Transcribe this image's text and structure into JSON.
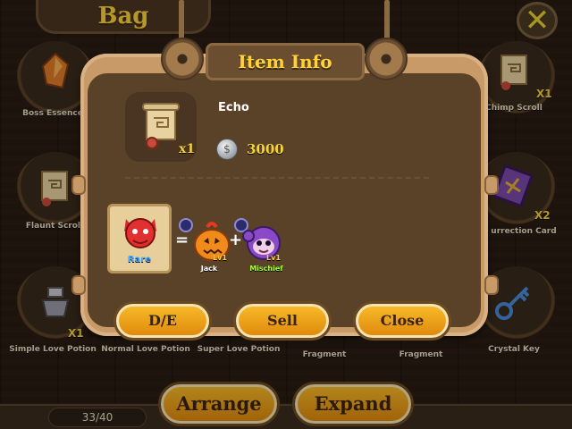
{
  "screen": {
    "title": "Bag",
    "close_icon": "x-close-icon"
  },
  "bag_items": [
    {
      "label": "Boss Essence",
      "count": "",
      "icon": "crystal-shard-icon"
    },
    {
      "label": "Flaunt Scroll",
      "count": "",
      "icon": "scroll-icon"
    },
    {
      "label": "Simple Love Potion",
      "count": "X1",
      "icon": "potion-icon"
    },
    {
      "label": "Normal Love Potion",
      "count": "",
      "icon": ""
    },
    {
      "label": "Super Love Potion",
      "count": "",
      "icon": ""
    },
    {
      "label": "Fragment",
      "count": "",
      "icon": ""
    },
    {
      "label": "Fragment",
      "count": "",
      "icon": ""
    },
    {
      "label": "Chimp Scroll",
      "count": "X1",
      "icon": "scroll-icon"
    },
    {
      "label": "urrection Card",
      "count": "X2",
      "icon": "card-icon"
    },
    {
      "label": "Crystal Key",
      "count": "",
      "icon": "key-icon"
    }
  ],
  "bottom": {
    "slots": "33/40",
    "arrange_label": "Arrange",
    "expand_label": "Expand"
  },
  "modal": {
    "title": "Item Info",
    "item": {
      "name": "Echo",
      "quantity": "x1",
      "price": "3000",
      "currency_icon": "silver-coin-icon"
    },
    "recipe": {
      "result_rarity": "Rare",
      "equals": "=",
      "plus": "+",
      "ingredients": [
        {
          "name": "Jack",
          "level": "Lv1",
          "name_color": "#ffffff"
        },
        {
          "name": "Mischief",
          "level": "Lv1",
          "name_color": "#9cff3a"
        }
      ]
    },
    "buttons": {
      "de": "D/E",
      "sell": "Sell",
      "close": "Close"
    }
  },
  "colors": {
    "title_gold": "#ffd23a",
    "button_orange": "#f0a01c",
    "panel_tan": "#c79a68",
    "panel_dark": "#5a4228"
  }
}
